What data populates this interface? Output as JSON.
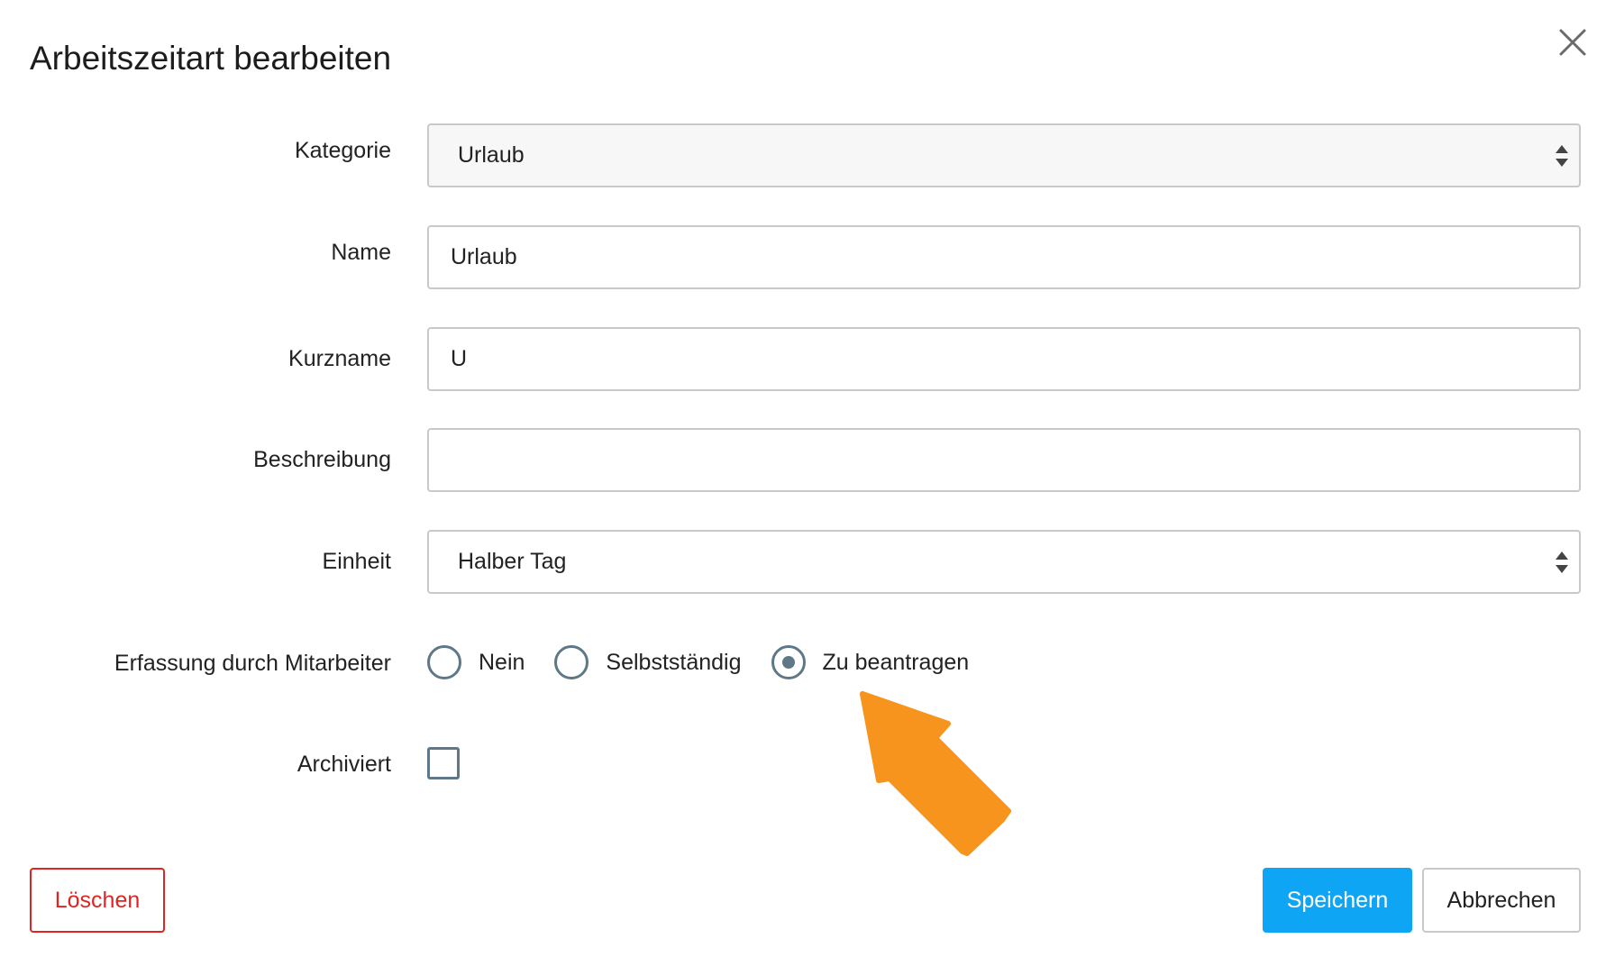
{
  "dialog": {
    "title": "Arbeitszeitart bearbeiten",
    "close_icon": "close-icon"
  },
  "form": {
    "kategorie": {
      "label": "Kategorie",
      "value": "Urlaub"
    },
    "name": {
      "label": "Name",
      "value": "Urlaub"
    },
    "kurzname": {
      "label": "Kurzname",
      "value": "U"
    },
    "beschreibung": {
      "label": "Beschreibung",
      "value": ""
    },
    "einheit": {
      "label": "Einheit",
      "value": "Halber Tag"
    },
    "erfassung": {
      "label": "Erfassung durch Mitarbeiter",
      "options": [
        "Nein",
        "Selbstständig",
        "Zu beantragen"
      ],
      "selected": "Zu beantragen"
    },
    "archiviert": {
      "label": "Archiviert",
      "checked": false
    }
  },
  "buttons": {
    "delete": "Löschen",
    "save": "Speichern",
    "cancel": "Abbrechen"
  },
  "colors": {
    "accent": "#0ea5f5",
    "danger": "#e02424",
    "control": "#5e7887",
    "annotation": "#f7941d"
  },
  "annotation": {
    "icon": "orange-pointer-arrow"
  }
}
